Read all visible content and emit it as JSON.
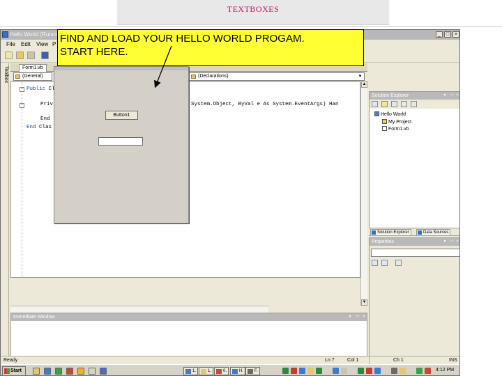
{
  "slide": {
    "title": "TEXTBOXES"
  },
  "window": {
    "title": "Hello World (Running) - Microsoft Visual Basic 2005 Express Edition",
    "controls": [
      "_",
      "□",
      "×"
    ]
  },
  "menu": {
    "items": [
      "File",
      "Edit",
      "View",
      "P"
    ]
  },
  "toolbox": {
    "label": "Toolbox"
  },
  "editor": {
    "tab_label": "Form1.vb",
    "object_combo": "(General)",
    "member_combo": "(Declarations)",
    "code_lines": [
      {
        "kw": "Public",
        "rest": " Cl"
      },
      {
        "kw": "",
        "rest": "Priv"
      },
      {
        "kw": "",
        "rest": "System.Object, ByVal e As System.EventArgs) Han"
      },
      {
        "kw": "",
        "rest": "End"
      },
      {
        "kw": "End",
        "rest": " Clas"
      }
    ]
  },
  "form_designer": {
    "button_label": "Button1"
  },
  "callout": {
    "line1": "FIND AND LOAD YOUR HELLO WORLD PROGAM.",
    "line2": "START HERE."
  },
  "solution_explorer": {
    "title": "Solution Explorer",
    "tree": [
      "Hello World",
      "My Project",
      "Form1.vb"
    ],
    "tabs": [
      "Solution Explorer",
      "Data Sources"
    ]
  },
  "properties": {
    "title": "Properties"
  },
  "immediate_window": {
    "title": "Immediate Window"
  },
  "statusbar": {
    "ready": "Ready",
    "ln": "Ln 7",
    "col": "Col 1",
    "ch": "Ch 1",
    "ins": "INS"
  },
  "taskbar": {
    "start_label": "Start",
    "tasks": [
      "1.",
      "0.",
      "H.",
      "F."
    ],
    "clock": "4:12 PM"
  },
  "colors": {
    "callout_fill": "#ffff33",
    "title_text": "#c0106a"
  }
}
